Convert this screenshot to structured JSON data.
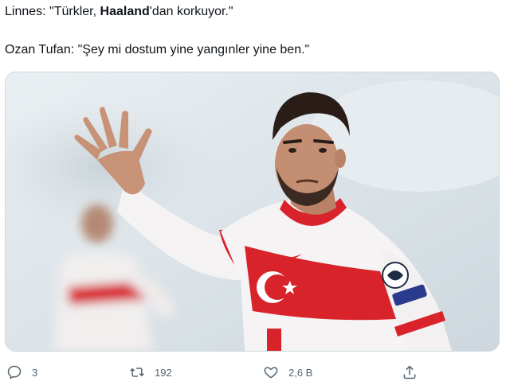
{
  "tweet": {
    "line1": {
      "prefix": "Linnes: \"Türkler, ",
      "bold": "Haaland",
      "suffix": "'dan korkuyor.\""
    },
    "line2": "Ozan Tufan: \"Şey mi dostum yine yangınler yine ben.\""
  },
  "actions": {
    "reply": {
      "icon": "reply-icon",
      "count": "3"
    },
    "retweet": {
      "icon": "retweet-icon",
      "count": "192"
    },
    "like": {
      "icon": "heart-icon",
      "count": "2,6 B"
    },
    "share": {
      "icon": "share-icon"
    }
  },
  "colors": {
    "text": "#0f1419",
    "muted": "#536471",
    "jersey_red": "#d8232a",
    "border": "#cfd9de"
  }
}
